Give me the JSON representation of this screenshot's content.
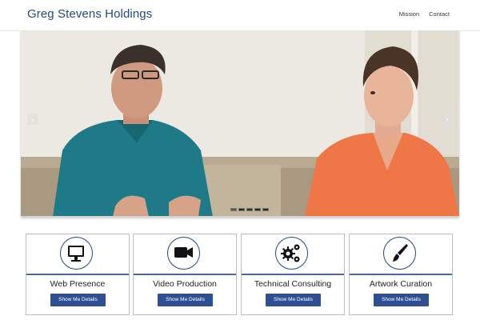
{
  "header": {
    "brand": "Greg Stevens Holdings",
    "nav": [
      {
        "label": "Mission"
      },
      {
        "label": "Contact"
      }
    ]
  },
  "carousel": {
    "prev_icon": "chevron-left-icon",
    "next_icon": "chevron-right-icon",
    "active_slide_index": 0
  },
  "services": [
    {
      "title": "Web Presence",
      "icon": "monitor-icon",
      "button": "Show Me Details"
    },
    {
      "title": "Video Production",
      "icon": "video-camera-icon",
      "button": "Show Me Details"
    },
    {
      "title": "Technical Consulting",
      "icon": "gears-icon",
      "button": "Show Me Details"
    },
    {
      "title": "Artwork Curation",
      "icon": "paintbrush-icon",
      "button": "Show Me Details"
    }
  ],
  "colors": {
    "brand": "#23497f",
    "button": "#2f4f94"
  }
}
